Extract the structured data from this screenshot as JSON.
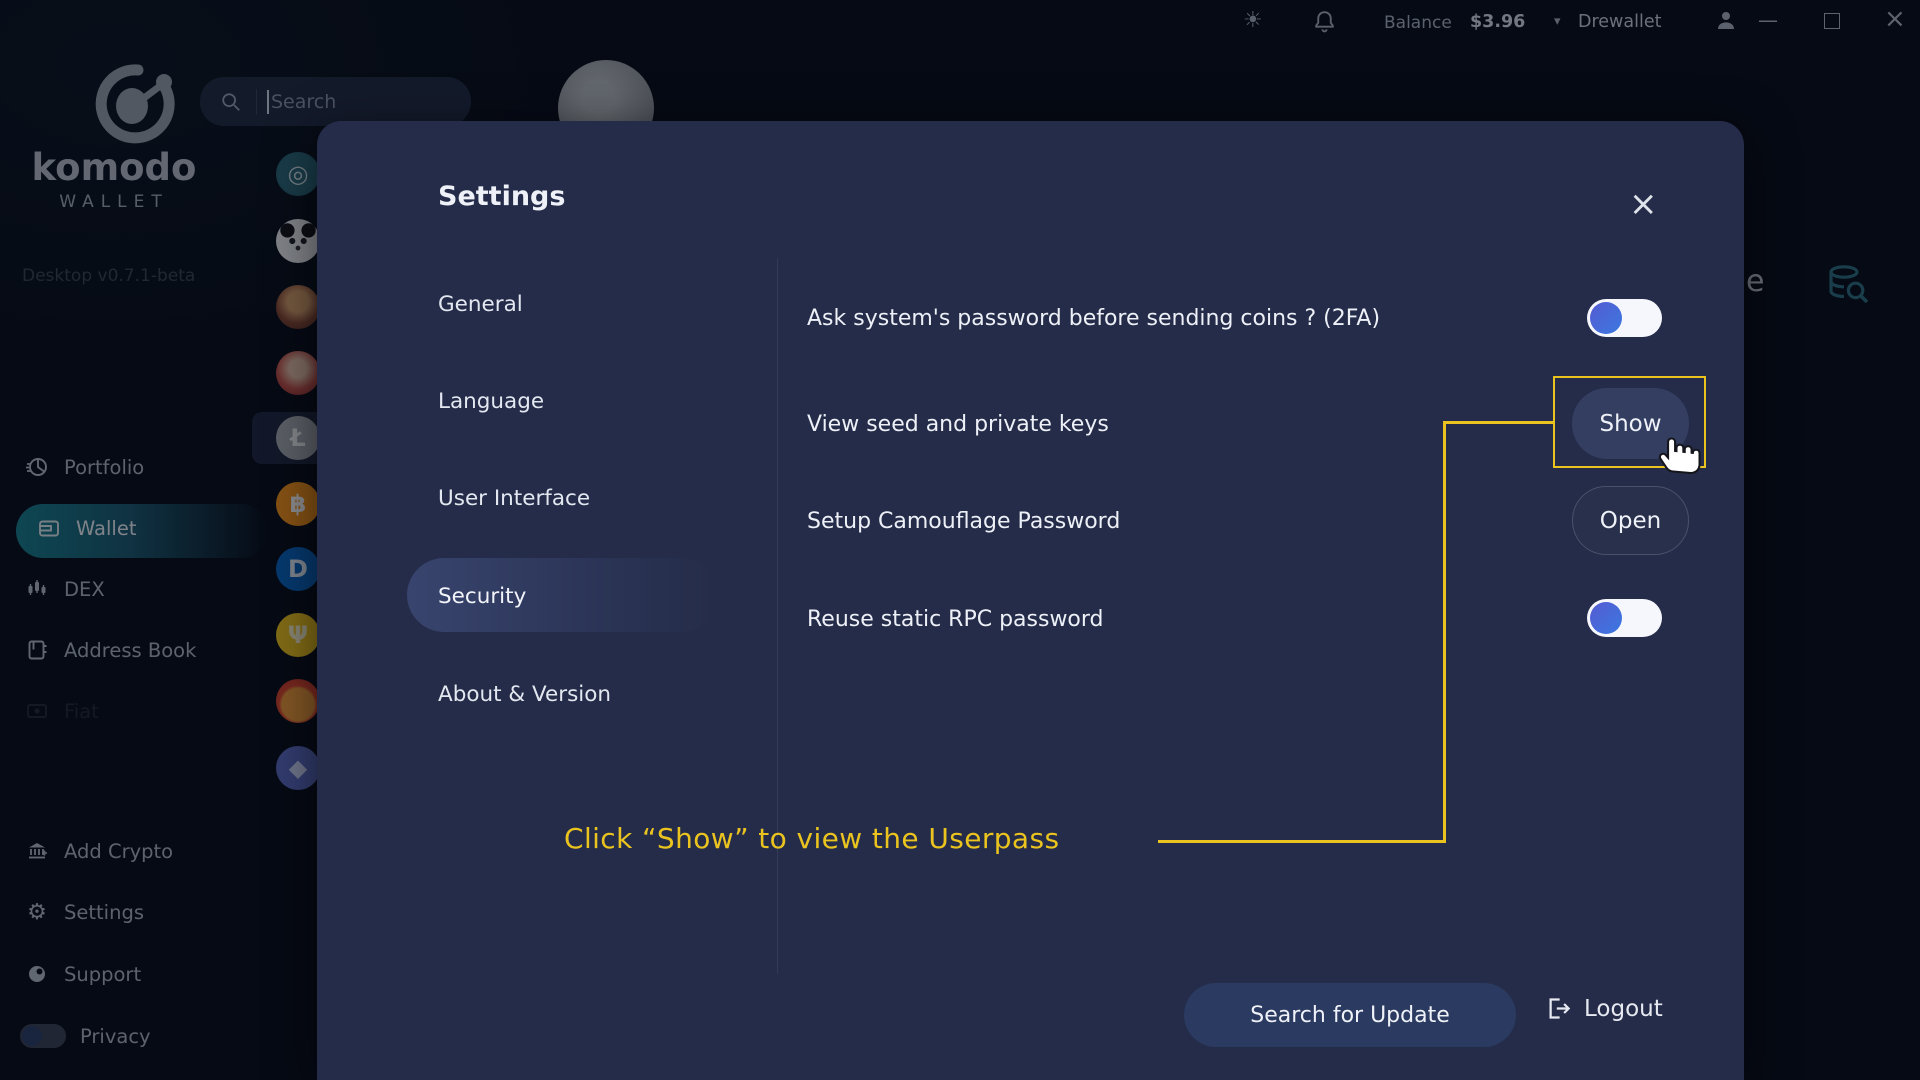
{
  "topbar": {
    "balance_label": "Balance",
    "balance_value": "$3.96",
    "account_name": "Drewallet"
  },
  "icons": {
    "sun": "☀",
    "caret_down": "▾",
    "minimize": "—",
    "close_window": "×",
    "modal_close": "×",
    "gear": "⚙"
  },
  "brand": {
    "name": "komodo",
    "subtitle": "WALLET",
    "version": "Desktop v0.7.1-beta"
  },
  "search": {
    "placeholder": "Search"
  },
  "sidebar": {
    "main": [
      {
        "label": "Portfolio"
      },
      {
        "label": "Wallet",
        "active": true
      },
      {
        "label": "DEX"
      },
      {
        "label": "Address Book"
      },
      {
        "label": "Fiat",
        "faint": true
      }
    ],
    "bottom": [
      {
        "label": "Add Crypto"
      },
      {
        "label": "Settings"
      },
      {
        "label": "Support"
      },
      {
        "label": "Privacy",
        "toggle_state": "off"
      }
    ]
  },
  "coins": [
    {
      "name": "komodo",
      "bg": "radial-gradient(circle at 50% 50%, #2e6b7c 58%, #245a69 100%)",
      "glyph": "◎",
      "fg": "#d7e6ea"
    },
    {
      "name": "panda",
      "bg": "radial-gradient(circle at 26% 26%, #15151c 15%, rgba(0,0,0,0) 16%), radial-gradient(circle at 74% 26%, #15151c 15%, rgba(0,0,0,0) 16%), radial-gradient(circle at 37% 50%, #23232b 8%, rgba(0,0,0,0) 9%), radial-gradient(circle at 63% 50%, #23232b 8%, rgba(0,0,0,0) 9%), radial-gradient(circle at 50% 66%, #35353d 6%, rgba(0,0,0,0) 7%), #eef0f2",
      "glyph": "",
      "fg": "#222"
    },
    {
      "name": "avatar-coin-brown",
      "bg": "radial-gradient(circle at 50% 38%, #d9a06b 30%, #8a4a35 62%, #5d2c26 100%)",
      "glyph": "",
      "fg": ""
    },
    {
      "name": "avatar-coin-red",
      "bg": "radial-gradient(circle at 50% 40%, #e8c0a6 26%, #c4524a 60%, #8e2f2c 100%)",
      "glyph": "",
      "fg": ""
    },
    {
      "name": "litecoin",
      "bg": "#a9adb2",
      "glyph": "Ł",
      "fg": "#f4f5f6"
    },
    {
      "name": "bitcoin",
      "bg": "#f7931a",
      "glyph": "฿",
      "fg": "#ffffff"
    },
    {
      "name": "digibyte",
      "bg": "#0b66c3",
      "glyph": "D",
      "fg": "#eaf2fb"
    },
    {
      "name": "psi-coin",
      "bg": "#f2c51d",
      "glyph": "Ψ",
      "fg": "#fdf4cd"
    },
    {
      "name": "shiba-inu",
      "bg": "radial-gradient(circle at 50% 58%, #f29b3a 48%, #e0492f 56%, #c03326 100%)",
      "glyph": "",
      "fg": ""
    },
    {
      "name": "ethereum",
      "bg": "#5e6cc2",
      "glyph": "◆",
      "fg": "#cdd5f6"
    }
  ],
  "page_fragment": {
    "partial_text": "e"
  },
  "modal": {
    "title": "Settings",
    "tabs": [
      "General",
      "Language",
      "User Interface",
      "Security",
      "About & Version"
    ],
    "active_tab": "Security",
    "rows": [
      {
        "label": "Ask system's password before sending coins ? (2FA)",
        "control": "toggle",
        "state": "on"
      },
      {
        "label": "View seed and private keys",
        "control": "button",
        "action": "Show"
      },
      {
        "label": "Setup Camouflage Password",
        "control": "button-outline",
        "action": "Open"
      },
      {
        "label": "Reuse static RPC password",
        "control": "toggle",
        "state": "on"
      }
    ],
    "footer": {
      "update_label": "Search for Update",
      "logout_label": "Logout"
    }
  },
  "annotation": {
    "text": "Click “Show” to view the Userpass"
  },
  "colors": {
    "page_bg": "#0a0e1a",
    "modal_bg": "#242c49",
    "yellow": "#eac31f",
    "toggle_from": "#555bd2",
    "toggle_to": "#3b78e0",
    "btn_bg": "#333e61",
    "update_btn_bg": "#2b3a60",
    "teal": "#1a8a99"
  }
}
